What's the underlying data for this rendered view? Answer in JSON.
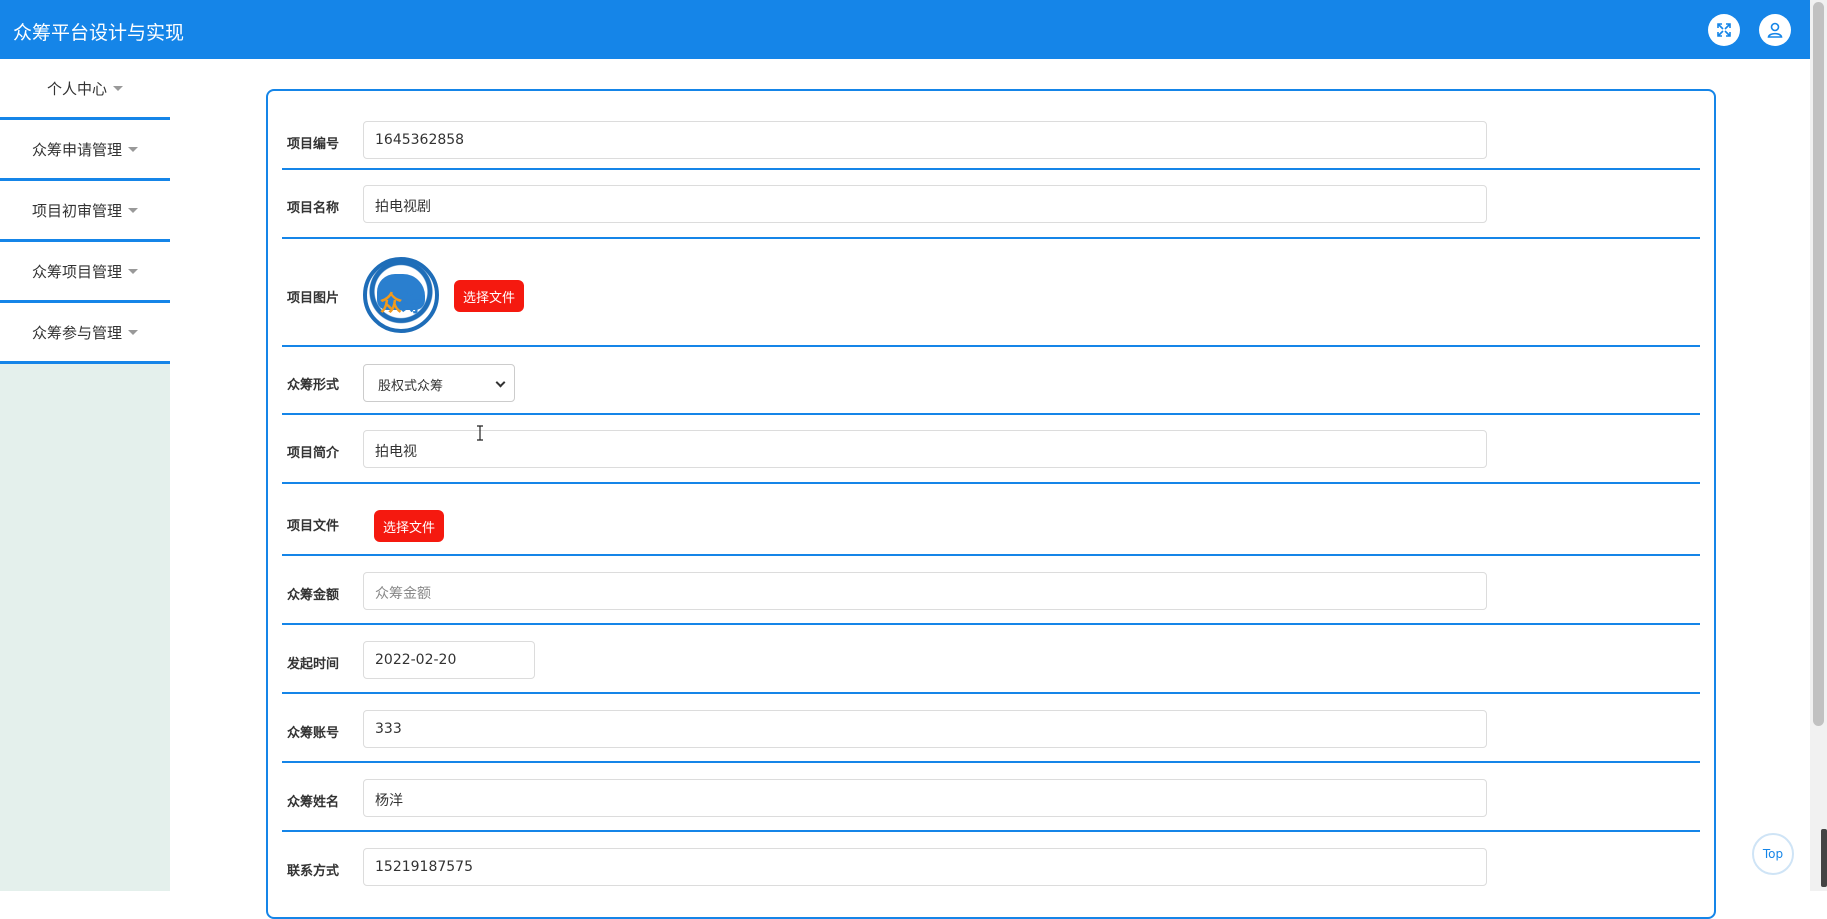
{
  "header": {
    "title": "众筹平台设计与实现"
  },
  "sidebar": {
    "items": [
      {
        "label": "个人中心"
      },
      {
        "label": "众筹申请管理"
      },
      {
        "label": "项目初审管理"
      },
      {
        "label": "众筹项目管理"
      },
      {
        "label": "众筹参与管理"
      }
    ]
  },
  "form": {
    "project_no": {
      "label": "项目编号",
      "value": "1645362858"
    },
    "project_name": {
      "label": "项目名称",
      "value": "拍电视剧"
    },
    "project_image": {
      "label": "项目图片",
      "button": "选择文件",
      "logo_text_a": "众",
      "logo_text_b": "筹"
    },
    "crowd_form": {
      "label": "众筹形式",
      "selected": "股权式众筹"
    },
    "project_intro": {
      "label": "项目简介",
      "value": "拍电视"
    },
    "project_file": {
      "label": "项目文件",
      "button": "选择文件"
    },
    "amount": {
      "label": "众筹金额",
      "placeholder": "众筹金额"
    },
    "start_time": {
      "label": "发起时间",
      "value": "2022-02-20"
    },
    "account": {
      "label": "众筹账号",
      "value": "333"
    },
    "name": {
      "label": "众筹姓名",
      "value": "杨洋"
    },
    "contact": {
      "label": "联系方式",
      "value": "15219187575"
    }
  },
  "top_button": {
    "label": "Top"
  },
  "icons": {
    "fullscreen": "fullscreen-icon",
    "user": "user-icon"
  },
  "colors": {
    "primary": "#1585e8",
    "danger": "#f5190f",
    "sidebar_bg": "#e4f0ec"
  }
}
